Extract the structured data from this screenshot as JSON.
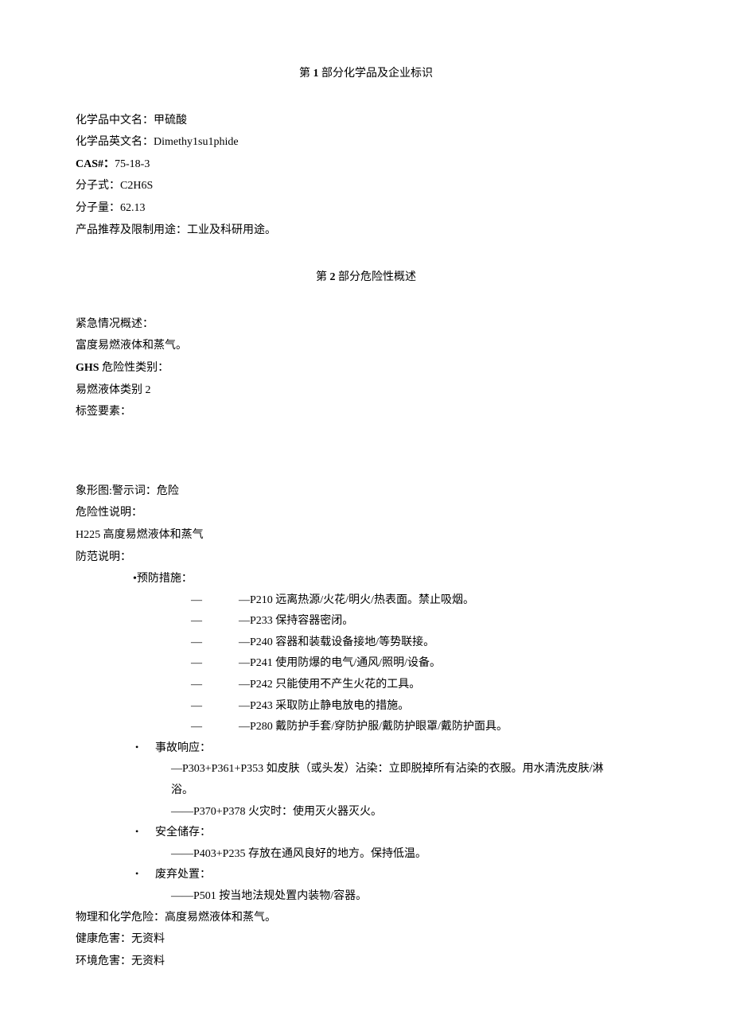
{
  "section1": {
    "title_pre": "第 ",
    "title_num": "1",
    "title_post": " 部分化学品及企业标识",
    "cn_name_label": "化学品中文名：",
    "cn_name": "甲硫酸",
    "en_name_label": "化学品英文名：",
    "en_name": "Dimethy1su1phide",
    "cas_label": "CAS#：",
    "cas": "75-18-3",
    "formula_label": "分子式：",
    "formula": "C2H6S",
    "weight_label": "分子量：",
    "weight": "62.13",
    "usage_label": "产品推荐及限制用途：",
    "usage": "工业及科研用途。"
  },
  "section2": {
    "title_pre": "第 ",
    "title_num": "2",
    "title_post": " 部分危险性概述",
    "emergency_label": "紧急情况概述：",
    "emergency": "富度易燃液体和蒸气。",
    "ghs_label": "GHS",
    "ghs_label2": " 危险性类别：",
    "ghs_value": "易燃液体类别 2",
    "tag_label": "标签要素：",
    "pictogram_label": "象形图:",
    "signal_label": "警示词：",
    "signal": "危险",
    "hazard_label": "危险性说明：",
    "hazard": "H225 高度易燃液体和蒸气",
    "precaution_label": "防范说明：",
    "prevention_label": "•预防措施：",
    "prevention": {
      "p1": "—P210 远离热源/火花/明火/热表面。禁止吸烟。",
      "p2": "—P233 保持容器密闭。",
      "p3": "—P240 容器和装载设备接地/等势联接。",
      "p4": "—P241 使用防爆的电气/通风/照明/设备。",
      "p5": "—P242 只能使用不产生火花的工具。",
      "p6": "—P243 采取防止静电放电的措施。",
      "p7": "—P280 戴防护手套/穿防护服/戴防护眼罩/戴防护面具。"
    },
    "response_label": "事故响应：",
    "response": {
      "r1_pre": "—P303+P361+P353 如皮肤（或头发）沾染：立即脱掉所有沾染的衣服。用水清洗皮肤/淋",
      "r1_cont": "浴。",
      "r2": "——P370+P378 火灾时：使用灭火器灭火。"
    },
    "storage_label": "安全储存：",
    "storage": "——P403+P235 存放在通风良好的地方。保持低温。",
    "disposal_label": "废弃处置：",
    "disposal": "——P501 按当地法规处置内装物/容器。",
    "phys_label": "物理和化学危险：",
    "phys": "高度易燃液体和蒸气。",
    "health_label": "健康危害：",
    "health": "无资料",
    "env_label": "环境危害：",
    "env": "无资料",
    "dash": "—"
  }
}
